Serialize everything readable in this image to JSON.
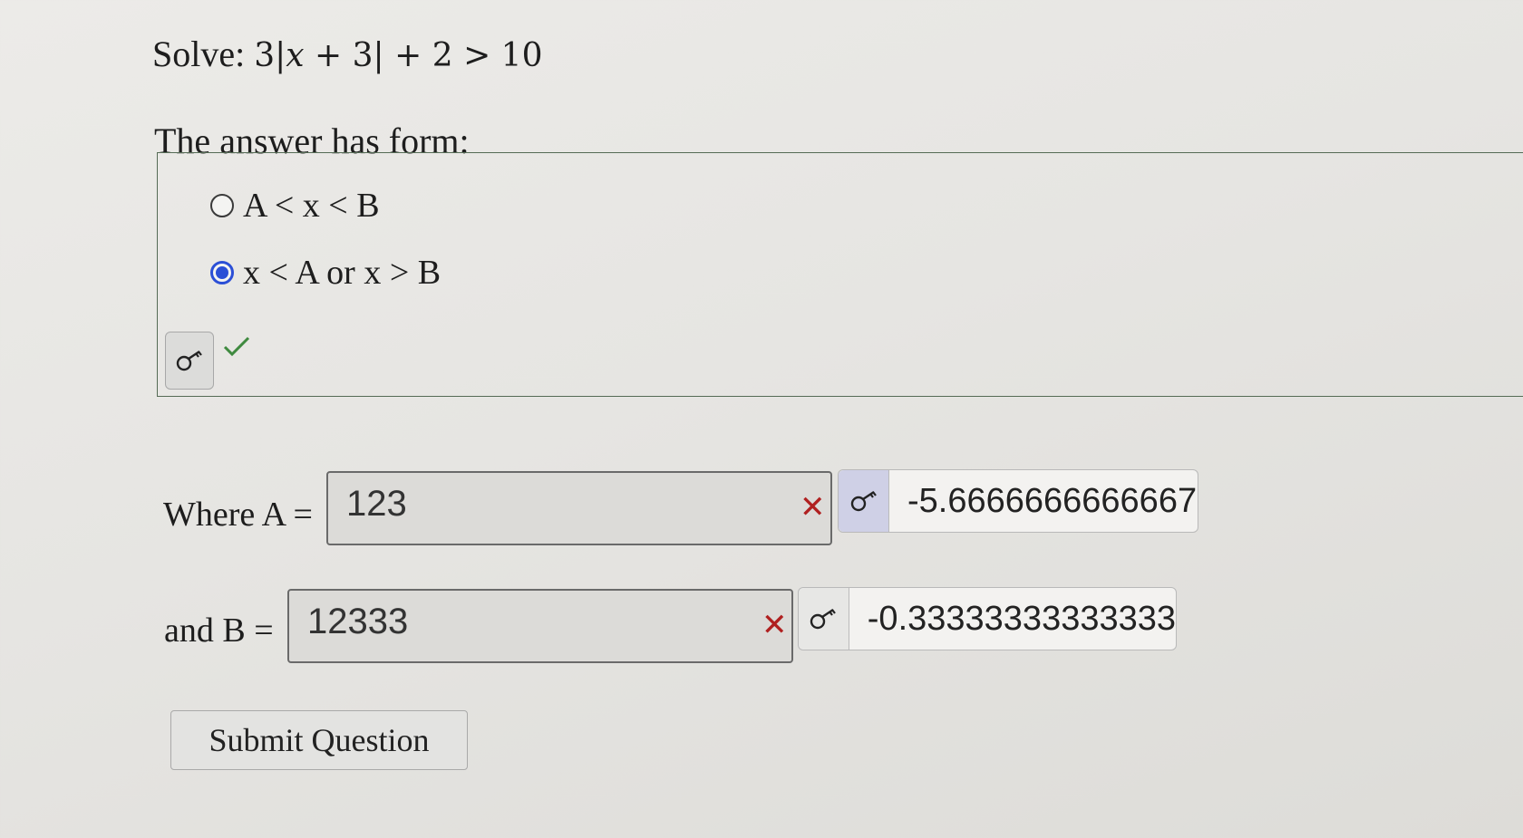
{
  "problem": {
    "prefix": "Solve:",
    "math_a": "3|",
    "math_var": "x",
    "math_b": " + 3| + 2 > 10"
  },
  "answer_form_label": "The answer has form:",
  "choices": [
    {
      "label": "A < x < B",
      "selected": false
    },
    {
      "label": "x < A or x > B",
      "selected": true
    }
  ],
  "fields": {
    "a": {
      "label": "Where A =",
      "value": "123",
      "correct": "-5.6666666666667"
    },
    "b": {
      "label": "and B =",
      "value": "12333",
      "correct": "-0.33333333333333"
    }
  },
  "status": {
    "wrong_mark": "✕"
  },
  "submit_label": "Submit Question",
  "colors": {
    "accent": "#2b4fd6",
    "correct": "#3f8a3f",
    "wrong": "#b02020"
  }
}
